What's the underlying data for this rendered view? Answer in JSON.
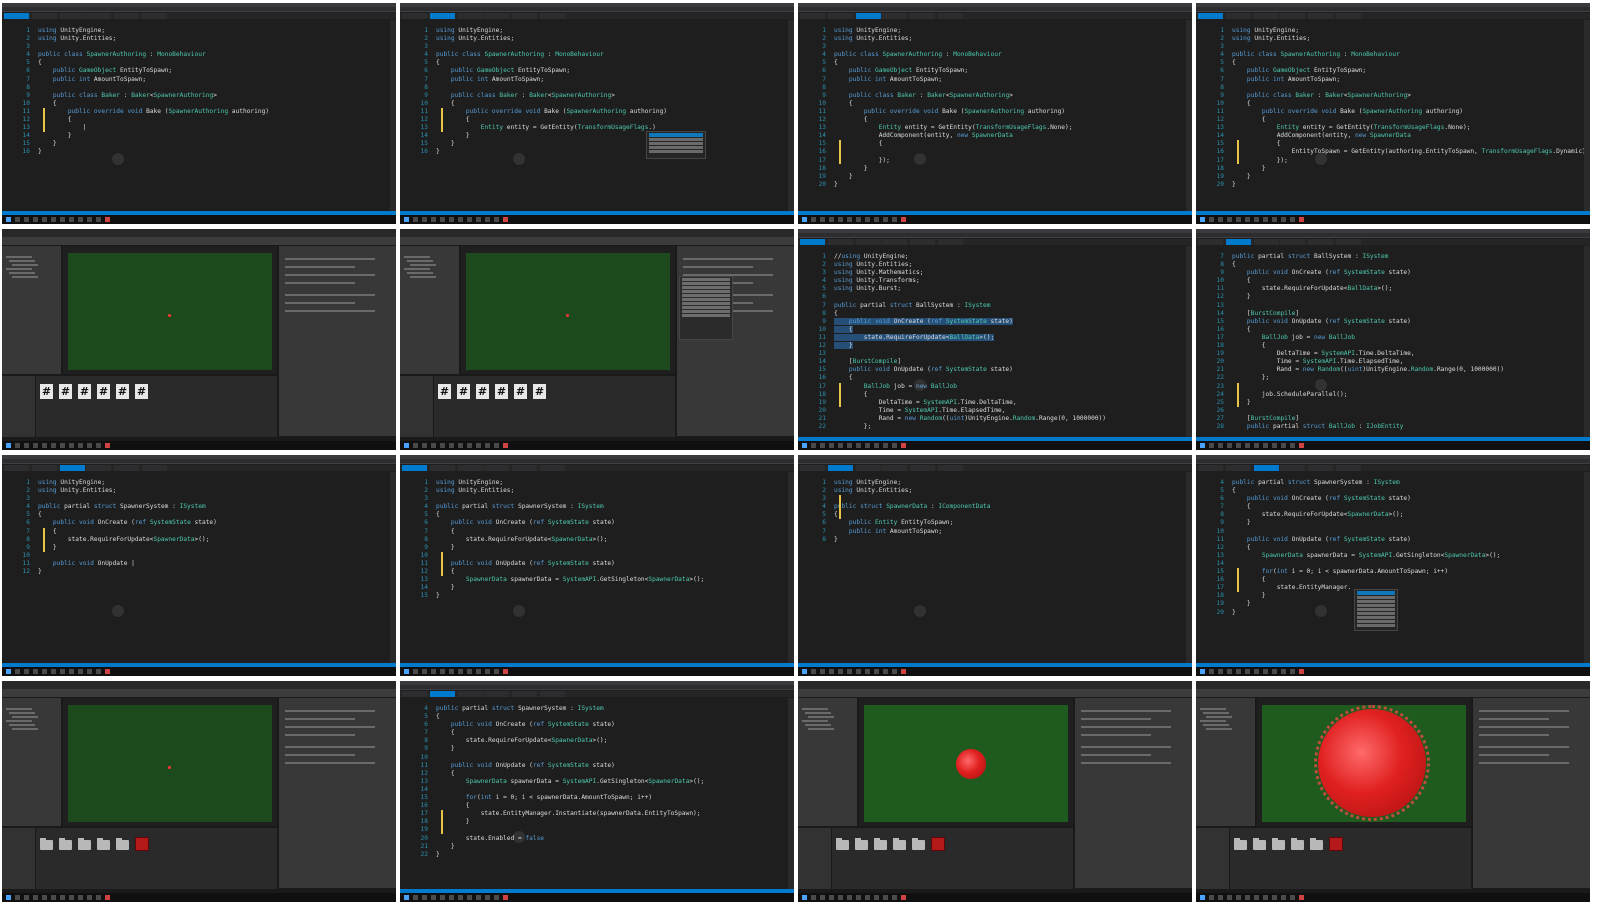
{
  "frames": [
    {
      "kind": "code",
      "lines": [
        {
          "n": "1",
          "t": "using UnityEngine;"
        },
        {
          "n": "2",
          "t": "using Unity.Entities;"
        },
        {
          "n": "3",
          "t": ""
        },
        {
          "n": "4",
          "t": "public class SpawnerAuthoring : MonoBehaviour"
        },
        {
          "n": "5",
          "t": "{"
        },
        {
          "n": "6",
          "t": "    public GameObject EntityToSpawn;"
        },
        {
          "n": "7",
          "t": "    public int AmountToSpawn;"
        },
        {
          "n": "8",
          "t": ""
        },
        {
          "n": "9",
          "t": "    public class Baker : Baker<SpawnerAuthoring>"
        },
        {
          "n": "10",
          "t": "    {"
        },
        {
          "n": "11",
          "t": "        public override void Bake (SpawnerAuthoring authoring)"
        },
        {
          "n": "12",
          "t": "        {"
        },
        {
          "n": "13",
          "t": "            |"
        },
        {
          "n": "14",
          "t": "        }"
        },
        {
          "n": "15",
          "t": "    }"
        },
        {
          "n": "16",
          "t": "}"
        }
      ]
    },
    {
      "kind": "code",
      "lines": [
        {
          "n": "1",
          "t": "using UnityEngine;"
        },
        {
          "n": "2",
          "t": "using Unity.Entities;"
        },
        {
          "n": "3",
          "t": ""
        },
        {
          "n": "4",
          "t": "public class SpawnerAuthoring : MonoBehaviour"
        },
        {
          "n": "5",
          "t": "{"
        },
        {
          "n": "6",
          "t": "    public GameObject EntityToSpawn;"
        },
        {
          "n": "7",
          "t": "    public int AmountToSpawn;"
        },
        {
          "n": "8",
          "t": ""
        },
        {
          "n": "9",
          "t": "    public class Baker : Baker<SpawnerAuthoring>"
        },
        {
          "n": "10",
          "t": "    {"
        },
        {
          "n": "11",
          "t": "        public override void Bake (SpawnerAuthoring authoring)"
        },
        {
          "n": "12",
          "t": "        {"
        },
        {
          "n": "13",
          "t": "            Entity entity = GetEntity(TransformUsageFlags.)"
        },
        {
          "n": "14",
          "t": "        }"
        },
        {
          "n": "15",
          "t": "    }"
        },
        {
          "n": "16",
          "t": "}"
        }
      ]
    },
    {
      "kind": "code",
      "lines": [
        {
          "n": "1",
          "t": "using UnityEngine;"
        },
        {
          "n": "2",
          "t": "using Unity.Entities;"
        },
        {
          "n": "3",
          "t": ""
        },
        {
          "n": "4",
          "t": "public class SpawnerAuthoring : MonoBehaviour"
        },
        {
          "n": "5",
          "t": "{"
        },
        {
          "n": "6",
          "t": "    public GameObject EntityToSpawn;"
        },
        {
          "n": "7",
          "t": "    public int AmountToSpawn;"
        },
        {
          "n": "8",
          "t": ""
        },
        {
          "n": "9",
          "t": "    public class Baker : Baker<SpawnerAuthoring>"
        },
        {
          "n": "10",
          "t": "    {"
        },
        {
          "n": "11",
          "t": "        public override void Bake (SpawnerAuthoring authoring)"
        },
        {
          "n": "12",
          "t": "        {"
        },
        {
          "n": "13",
          "t": "            Entity entity = GetEntity(TransformUsageFlags.None);"
        },
        {
          "n": "14",
          "t": "            AddComponent(entity, new SpawnerData"
        },
        {
          "n": "15",
          "t": "            {"
        },
        {
          "n": "16",
          "t": ""
        },
        {
          "n": "17",
          "t": "            });"
        },
        {
          "n": "18",
          "t": "        }"
        },
        {
          "n": "19",
          "t": "    }"
        },
        {
          "n": "20",
          "t": "}"
        }
      ]
    },
    {
      "kind": "code",
      "lines": [
        {
          "n": "1",
          "t": "using UnityEngine;"
        },
        {
          "n": "2",
          "t": "using Unity.Entities;"
        },
        {
          "n": "3",
          "t": ""
        },
        {
          "n": "4",
          "t": "public class SpawnerAuthoring : MonoBehaviour"
        },
        {
          "n": "5",
          "t": "{"
        },
        {
          "n": "6",
          "t": "    public GameObject EntityToSpawn;"
        },
        {
          "n": "7",
          "t": "    public int AmountToSpawn;"
        },
        {
          "n": "8",
          "t": ""
        },
        {
          "n": "9",
          "t": "    public class Baker : Baker<SpawnerAuthoring>"
        },
        {
          "n": "10",
          "t": "    {"
        },
        {
          "n": "11",
          "t": "        public override void Bake (SpawnerAuthoring authoring)"
        },
        {
          "n": "12",
          "t": "        {"
        },
        {
          "n": "13",
          "t": "            Entity entity = GetEntity(TransformUsageFlags.None);"
        },
        {
          "n": "14",
          "t": "            AddComponent(entity, new SpawnerData"
        },
        {
          "n": "15",
          "t": "            {"
        },
        {
          "n": "16",
          "t": "                EntityToSpawn = GetEntity(authoring.EntityToSpawn, TransformUsageFlags.Dynamic)"
        },
        {
          "n": "17",
          "t": "            });"
        },
        {
          "n": "18",
          "t": "        }"
        },
        {
          "n": "19",
          "t": "    }"
        },
        {
          "n": "20",
          "t": "}"
        }
      ]
    },
    {
      "kind": "unity",
      "assets": "scripts",
      "game": "dot"
    },
    {
      "kind": "unity",
      "assets": "scripts",
      "game": "dot",
      "inspectorMenu": true
    },
    {
      "kind": "code",
      "start": 1,
      "lines": [
        {
          "n": "1",
          "t": "//using UnityEngine;"
        },
        {
          "n": "2",
          "t": "using Unity.Entities;"
        },
        {
          "n": "3",
          "t": "using Unity.Mathematics;"
        },
        {
          "n": "4",
          "t": "using Unity.Transforms;"
        },
        {
          "n": "5",
          "t": "using Unity.Burst;"
        },
        {
          "n": "6",
          "t": ""
        },
        {
          "n": "7",
          "t": "public partial struct BallSystem : ISystem"
        },
        {
          "n": "8",
          "t": "{"
        },
        {
          "n": "9",
          "t": "    public void OnCreate (ref SystemState state)",
          "sel": true
        },
        {
          "n": "10",
          "t": "    {",
          "sel": true
        },
        {
          "n": "11",
          "t": "        state.RequireForUpdate<BallData>();",
          "sel": true
        },
        {
          "n": "12",
          "t": "    }",
          "sel": true
        },
        {
          "n": "13",
          "t": ""
        },
        {
          "n": "14",
          "t": "    [BurstCompile]"
        },
        {
          "n": "15",
          "t": "    public void OnUpdate (ref SystemState state)"
        },
        {
          "n": "16",
          "t": "    {"
        },
        {
          "n": "17",
          "t": "        BallJob job = new BallJob"
        },
        {
          "n": "18",
          "t": "        {"
        },
        {
          "n": "19",
          "t": "            DeltaTime = SystemAPI.Time.DeltaTime,"
        },
        {
          "n": "20",
          "t": "            Time = SystemAPI.Time.ElapsedTime,"
        },
        {
          "n": "21",
          "t": "            Rand = new Random((uint)UnityEngine.Random.Range(0, 1000000))"
        },
        {
          "n": "22",
          "t": "        };"
        }
      ]
    },
    {
      "kind": "code",
      "lines": [
        {
          "n": "7",
          "t": "public partial struct BallSystem : ISystem"
        },
        {
          "n": "8",
          "t": "{"
        },
        {
          "n": "9",
          "t": "    public void OnCreate (ref SystemState state)"
        },
        {
          "n": "10",
          "t": "    {"
        },
        {
          "n": "11",
          "t": "        state.RequireForUpdate<BallData>();"
        },
        {
          "n": "12",
          "t": "    }"
        },
        {
          "n": "13",
          "t": ""
        },
        {
          "n": "14",
          "t": "    [BurstCompile]"
        },
        {
          "n": "15",
          "t": "    public void OnUpdate (ref SystemState state)"
        },
        {
          "n": "16",
          "t": "    {"
        },
        {
          "n": "17",
          "t": "        BallJob job = new BallJob"
        },
        {
          "n": "18",
          "t": "        {"
        },
        {
          "n": "19",
          "t": "            DeltaTime = SystemAPI.Time.DeltaTime,"
        },
        {
          "n": "20",
          "t": "            Time = SystemAPI.Time.ElapsedTime,"
        },
        {
          "n": "21",
          "t": "            Rand = new Random((uint)UnityEngine.Random.Range(0, 1000000))"
        },
        {
          "n": "22",
          "t": "        };"
        },
        {
          "n": "23",
          "t": ""
        },
        {
          "n": "24",
          "t": "        job.ScheduleParallel();"
        },
        {
          "n": "25",
          "t": "    }"
        },
        {
          "n": "26",
          "t": ""
        },
        {
          "n": "27",
          "t": "    [BurstCompile]"
        },
        {
          "n": "28",
          "t": "    public partial struct BallJob : IJobEntity"
        }
      ]
    },
    {
      "kind": "code",
      "lines": [
        {
          "n": "1",
          "t": "using UnityEngine;"
        },
        {
          "n": "2",
          "t": "using Unity.Entities;"
        },
        {
          "n": "3",
          "t": ""
        },
        {
          "n": "4",
          "t": "public partial struct SpawnerSystem : ISystem"
        },
        {
          "n": "5",
          "t": "{"
        },
        {
          "n": "6",
          "t": "    public void OnCreate (ref SystemState state)"
        },
        {
          "n": "7",
          "t": "    {"
        },
        {
          "n": "8",
          "t": "        state.RequireForUpdate<SpawnerData>();"
        },
        {
          "n": "9",
          "t": "    }"
        },
        {
          "n": "10",
          "t": ""
        },
        {
          "n": "11",
          "t": "    public void OnUpdate |"
        },
        {
          "n": "12",
          "t": "}"
        }
      ]
    },
    {
      "kind": "code",
      "lines": [
        {
          "n": "1",
          "t": "using UnityEngine;"
        },
        {
          "n": "2",
          "t": "using Unity.Entities;"
        },
        {
          "n": "3",
          "t": ""
        },
        {
          "n": "4",
          "t": "public partial struct SpawnerSystem : ISystem"
        },
        {
          "n": "5",
          "t": "{"
        },
        {
          "n": "6",
          "t": "    public void OnCreate (ref SystemState state)"
        },
        {
          "n": "7",
          "t": "    {"
        },
        {
          "n": "8",
          "t": "        state.RequireForUpdate<SpawnerData>();"
        },
        {
          "n": "9",
          "t": "    }"
        },
        {
          "n": "10",
          "t": ""
        },
        {
          "n": "11",
          "t": "    public void OnUpdate (ref SystemState state)"
        },
        {
          "n": "12",
          "t": "    {"
        },
        {
          "n": "13",
          "t": "        SpawnerData spawnerData = SystemAPI.GetSingleton<SpawnerData>();"
        },
        {
          "n": "14",
          "t": "    }"
        },
        {
          "n": "15",
          "t": "}"
        }
      ]
    },
    {
      "kind": "code",
      "lines": [
        {
          "n": "1",
          "t": "using UnityEngine;"
        },
        {
          "n": "2",
          "t": "using Unity.Entities;"
        },
        {
          "n": "3",
          "t": ""
        },
        {
          "n": "4",
          "t": "public struct SpawnerData : IComponentData"
        },
        {
          "n": "5",
          "t": "{"
        },
        {
          "n": "6",
          "t": "    public Entity EntityToSpawn;"
        },
        {
          "n": "7",
          "t": "    public int AmountToSpawn;"
        },
        {
          "n": "8",
          "t": "}"
        }
      ]
    },
    {
      "kind": "code",
      "lines": [
        {
          "n": "4",
          "t": "public partial struct SpawnerSystem : ISystem"
        },
        {
          "n": "5",
          "t": "{"
        },
        {
          "n": "6",
          "t": "    public void OnCreate (ref SystemState state)"
        },
        {
          "n": "7",
          "t": "    {"
        },
        {
          "n": "8",
          "t": "        state.RequireForUpdate<SpawnerData>();"
        },
        {
          "n": "9",
          "t": "    }"
        },
        {
          "n": "10",
          "t": ""
        },
        {
          "n": "11",
          "t": "    public void OnUpdate (ref SystemState state)"
        },
        {
          "n": "12",
          "t": "    {"
        },
        {
          "n": "13",
          "t": "        SpawnerData spawnerData = SystemAPI.GetSingleton<SpawnerData>();"
        },
        {
          "n": "14",
          "t": ""
        },
        {
          "n": "15",
          "t": "        for(int i = 0; i < spawnerData.AmountToSpawn; i++)"
        },
        {
          "n": "16",
          "t": "        {"
        },
        {
          "n": "17",
          "t": "            state.EntityManager."
        },
        {
          "n": "18",
          "t": "        }"
        },
        {
          "n": "19",
          "t": "    }"
        },
        {
          "n": "20",
          "t": "}"
        }
      ]
    },
    {
      "kind": "unity",
      "assets": "folders",
      "game": "dot"
    },
    {
      "kind": "code",
      "lines": [
        {
          "n": "4",
          "t": "public partial struct SpawnerSystem : ISystem"
        },
        {
          "n": "5",
          "t": "{"
        },
        {
          "n": "6",
          "t": "    public void OnCreate (ref SystemState state)"
        },
        {
          "n": "7",
          "t": "    {"
        },
        {
          "n": "8",
          "t": "        state.RequireForUpdate<SpawnerData>();"
        },
        {
          "n": "9",
          "t": "    }"
        },
        {
          "n": "10",
          "t": ""
        },
        {
          "n": "11",
          "t": "    public void OnUpdate (ref SystemState state)"
        },
        {
          "n": "12",
          "t": "    {"
        },
        {
          "n": "13",
          "t": "        SpawnerData spawnerData = SystemAPI.GetSingleton<SpawnerData>();"
        },
        {
          "n": "14",
          "t": ""
        },
        {
          "n": "15",
          "t": "        for(int i = 0; i < spawnerData.AmountToSpawn; i++)"
        },
        {
          "n": "16",
          "t": "        {"
        },
        {
          "n": "17",
          "t": "            state.EntityManager.Instantiate(spawnerData.EntityToSpawn);"
        },
        {
          "n": "18",
          "t": "        }"
        },
        {
          "n": "19",
          "t": ""
        },
        {
          "n": "20",
          "t": "        state.Enabled = false"
        },
        {
          "n": "21",
          "t": "    }"
        },
        {
          "n": "22",
          "t": "}"
        }
      ]
    },
    {
      "kind": "unity",
      "assets": "folders",
      "game": "small-blob"
    },
    {
      "kind": "unity",
      "assets": "folders",
      "game": "large-blob"
    }
  ],
  "colors": {
    "editor_bg": "#1e1e1e",
    "keyword": "#569cd6",
    "type": "#4ec9b0",
    "line_number": "#2b91af",
    "status_bar": "#007acc",
    "game_bg": "#1c4a1c",
    "ball": "#e02020"
  },
  "icons": {
    "asset_script": "#",
    "ball_prefab": "red-cube-icon",
    "folder": "folder-icon"
  }
}
